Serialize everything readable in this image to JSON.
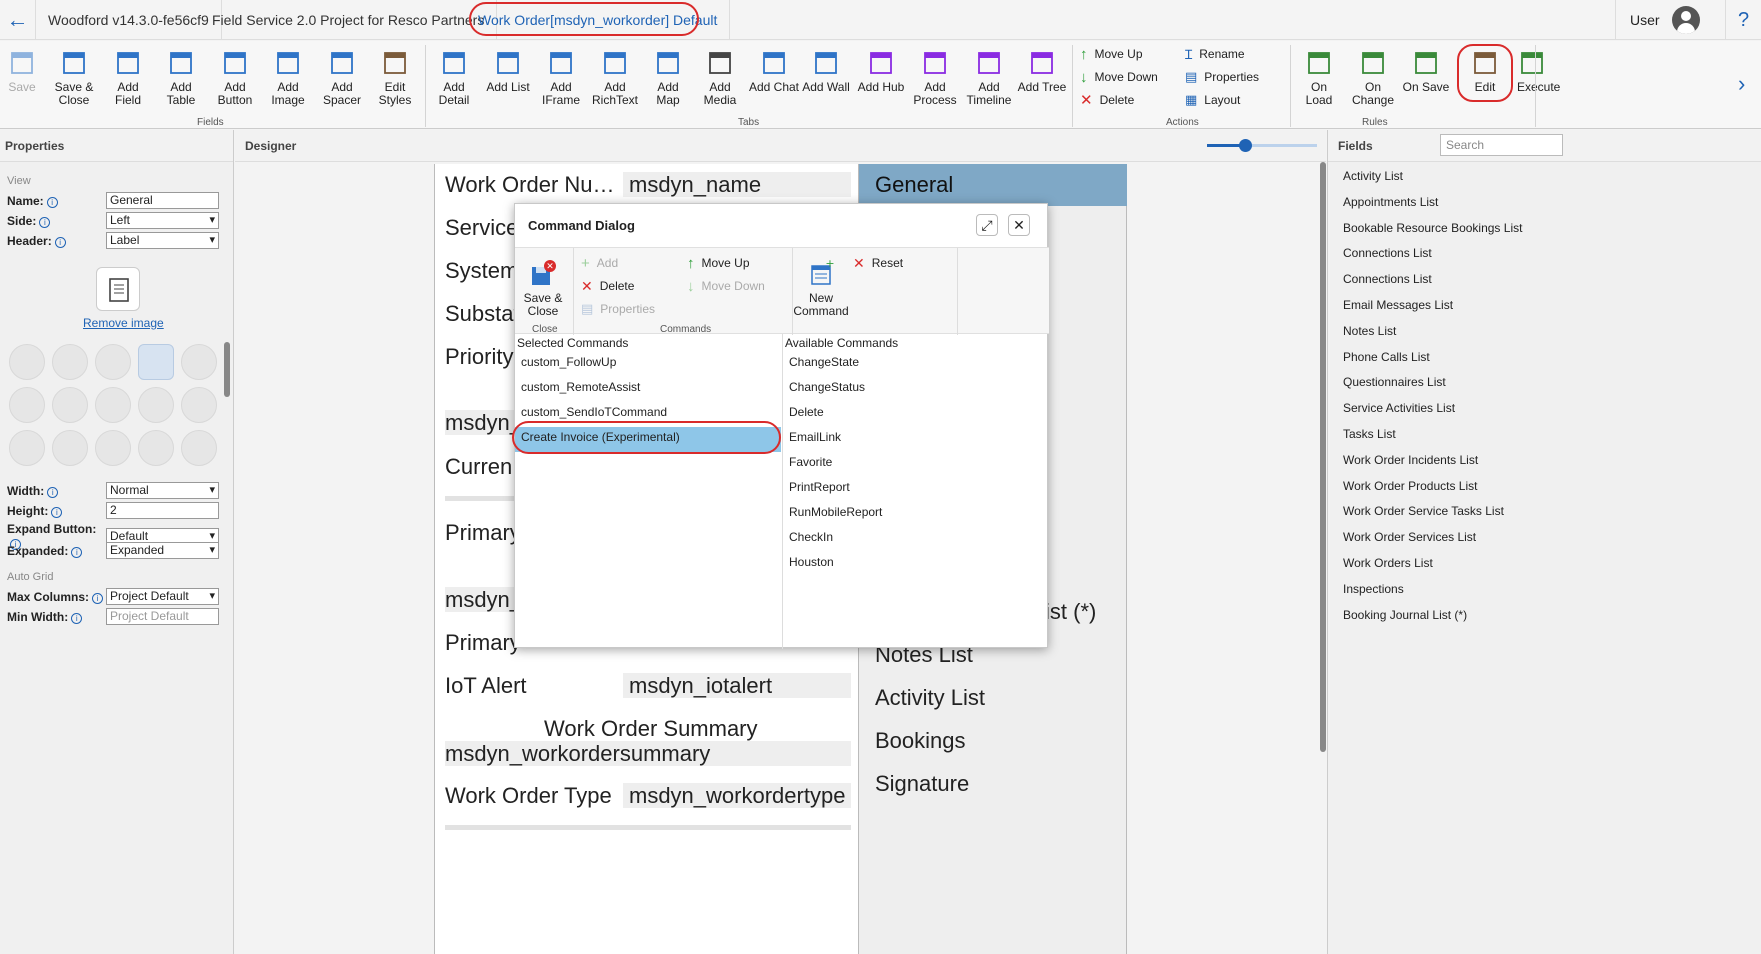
{
  "titlebar": {
    "tabs": [
      "Woodford v14.3.0-fe56cf9",
      "Field Service 2.0 Project for Resco Partners",
      "Work Order[msdyn_workorder] Default"
    ],
    "user": "User",
    "help": "?"
  },
  "ribbon": {
    "buttons": [
      "Save",
      "Save & Close",
      "Add Field",
      "Add Table",
      "Add Button",
      "Add Image",
      "Add Spacer",
      "Edit Styles",
      "Add Detail",
      "Add List",
      "Add IFrame",
      "Add RichText",
      "Add Map",
      "Add Media",
      "Add Chat",
      "Add Wall",
      "Add Hub",
      "Add Process",
      "Add Timeline",
      "Add Tree",
      "On Load",
      "On Change",
      "On Save",
      "Edit",
      "Execute"
    ],
    "small": [
      "Move Up",
      "Move Down",
      "Delete",
      "Rename",
      "Properties",
      "Layout"
    ],
    "groups": [
      "Fields",
      "Tabs",
      "Actions",
      "Rules"
    ]
  },
  "properties": {
    "title": "Properties",
    "view_label": "View",
    "name_label": "Name:",
    "name_value": "General",
    "side_label": "Side:",
    "side_value": "Left",
    "header_label": "Header:",
    "header_value": "Label",
    "remove_image": "Remove image",
    "width_label": "Width:",
    "width_value": "Normal",
    "height_label": "Height:",
    "height_value": "2",
    "expand_label": "Expand Button:",
    "expand_value": "Default",
    "expanded_label": "Expanded:",
    "expanded_value": "Expanded",
    "autogrid_label": "Auto Grid",
    "maxcol_label": "Max Columns:",
    "maxcol_value": "Project Default",
    "minwidth_label": "Min Width:",
    "minwidth_placeholder": "Project Default"
  },
  "designer": {
    "title": "Designer",
    "fields": [
      {
        "label": "Work Order Nu…",
        "value": "msdyn_name"
      },
      {
        "label": "Service",
        "value": ""
      },
      {
        "label": "System",
        "value": ""
      },
      {
        "label": "Substat",
        "value": ""
      },
      {
        "label": "Priority",
        "value": ""
      }
    ],
    "frag1": "msdyn_",
    "frag2": "Curren",
    "frag3": "Primary",
    "frag4": "msdyn_",
    "frag5": "Primary",
    "iot_label": "IoT Alert",
    "iot_value": "msdyn_iotalert",
    "summary_label": "Work Order Summary",
    "summary_value": "msdyn_workordersummary",
    "type_label": "Work Order Type",
    "type_value": "msdyn_workordertype",
    "tabs": [
      "General",
      "ist (*)",
      "Notes List",
      "Activity List",
      "Bookings",
      "Signature"
    ]
  },
  "fields_panel": {
    "title": "Fields",
    "search_placeholder": "Search",
    "items": [
      "Activity List",
      "Appointments List",
      "Bookable Resource Bookings List",
      "Connections List",
      "Connections List",
      "Email Messages List",
      "Notes List",
      "Phone Calls List",
      "Questionnaires List",
      "Service Activities List",
      "Tasks List",
      "Work Order Incidents List",
      "Work Order Products List",
      "Work Order Service Tasks List",
      "Work Order Services List",
      "Work Orders List",
      "Inspections",
      "Booking Journal List (*)"
    ]
  },
  "dialog": {
    "title": "Command Dialog",
    "save_close": "Save & Close",
    "close_group": "Close",
    "add": "Add",
    "delete": "Delete",
    "properties": "Properties",
    "move_up": "Move Up",
    "move_down": "Move Down",
    "commands_group": "Commands",
    "new_command": "New Command",
    "reset": "Reset",
    "selected_header": "Selected Commands",
    "available_header": "Available Commands",
    "selected": [
      "custom_FollowUp",
      "custom_RemoteAssist",
      "custom_SendIoTCommand",
      "Create Invoice (Experimental)"
    ],
    "available": [
      "ChangeState",
      "ChangeStatus",
      "Delete",
      "EmailLink",
      "Favorite",
      "PrintReport",
      "RunMobileReport",
      "CheckIn",
      "Houston"
    ]
  },
  "colors": {
    "accent": "#1f63b5",
    "highlight": "#d92b2b",
    "selected": "#8ec6e8",
    "tab_active": "#7fa8c6"
  }
}
